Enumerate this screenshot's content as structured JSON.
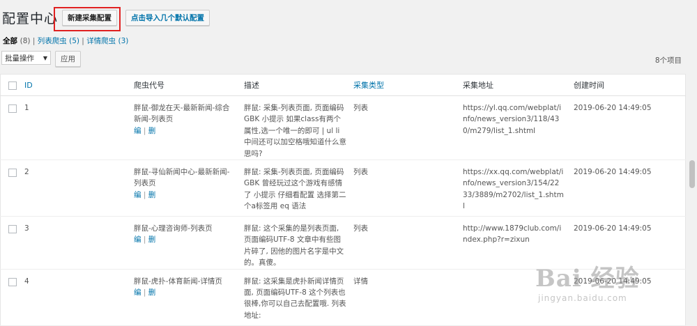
{
  "page": {
    "title": "配置中心",
    "new_button": "新建采集配置",
    "import_button": "点击导入几个默认配置"
  },
  "filters": {
    "all_label": "全部",
    "all_count": "(8)",
    "sep1": " | ",
    "list_label": "列表爬虫",
    "list_count": "(5)",
    "sep2": " | ",
    "detail_label": "详情爬虫",
    "detail_count": "(3)"
  },
  "toolbar": {
    "bulk_action": "批量操作",
    "apply_label": "应用",
    "item_count": "8个项目"
  },
  "table": {
    "columns": {
      "id": "ID",
      "code": "爬虫代号",
      "desc": "描述",
      "type": "采集类型",
      "url": "采集地址",
      "created": "创建时间"
    },
    "actions": {
      "edit": "编",
      "sep": " | ",
      "delete": "删"
    },
    "rows": [
      {
        "id": "1",
        "code": "胖鼠-御龙在天-最新新闻-综合新闻-列表页",
        "desc": "胖鼠: 采集-列表页面, 页面编码GBK 小提示 如果class有两个属性,选一个唯一的即可 | ul li 中间还可以加空格哦知道什么意思吗?",
        "type": "列表",
        "url": "https://yl.qq.com/webplat/info/news_version3/118/430/m279/list_1.shtml",
        "created": "2019-06-20 14:49:05"
      },
      {
        "id": "2",
        "code": "胖鼠-寻仙新闻中心-最新新闻-列表页",
        "desc": "胖鼠: 采集-列表页面, 页面编码GBK 曾经玩过这个游戏有感情了 小提示 仔细看配置 选择第二个a标签用 eq 语法",
        "type": "列表",
        "url": "https://xx.qq.com/webplat/info/news_version3/154/2233/3889/m2702/list_1.shtml",
        "created": "2019-06-20 14:49:05"
      },
      {
        "id": "3",
        "code": "胖鼠-心理咨询师-列表页",
        "desc": "胖鼠: 这个采集的是列表页面, 页面编码UTF-8 文章中有些图片碎了, 因他的图片名字是中文的。真傻。",
        "type": "列表",
        "url": "http://www.1879club.com/index.php?r=zixun",
        "created": "2019-06-20 14:49:05"
      },
      {
        "id": "4",
        "code": "胖鼠-虎扑-体育新闻-详情页",
        "desc": "胖鼠: 这采集是虎扑新闻详情页面, 页面编码UTF-8 这个列表也很棒,你可以自己去配置哦. 列表地址:",
        "type": "详情",
        "url": "",
        "created": "2019-06-20 14:49:05"
      }
    ]
  },
  "watermark": {
    "brand": "Bai 经验",
    "url": "jingyan.baidu.com"
  },
  "colors": {
    "link": "#0073aa",
    "highlight_border": "#e02020",
    "background": "#f1f1f1"
  }
}
